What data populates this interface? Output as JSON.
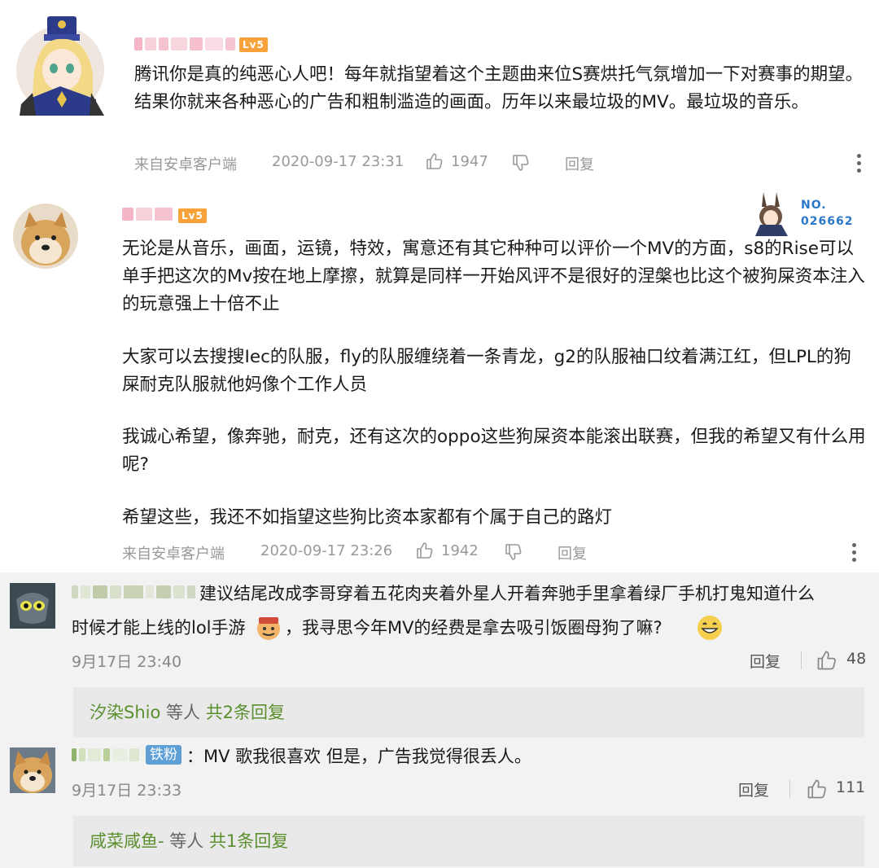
{
  "comments_top": [
    {
      "level_badge": "Lv5",
      "text": "腾讯你是真的纯恶心人吧！每年就指望着这个主题曲来位S赛烘托气氛增加一下对赛事的期望。结果你就来各种恶心的广告和粗制滥造的画面。历年以来最垃圾的MV。最垃圾的音乐。",
      "source": "来自安卓客户端",
      "time": "2020-09-17 23:31",
      "likes": "1947",
      "reply_label": "回复"
    },
    {
      "level_badge": "Lv5",
      "badge_no_label": "NO.",
      "badge_no_value": "026662",
      "paragraphs": [
        "无论是从音乐，画面，运镜，特效，寓意还有其它种种可以评价一个MV的方面，s8的Rise可以单手把这次的Mv按在地上摩擦，就算是同样一开始风评不是很好的涅槃也比这个被狗屎资本注入的玩意强上十倍不止",
        "大家可以去搜搜Iec的队服，fly的队服缠绕着一条青龙，g2的队服袖口纹着满江红，但LPL的狗屎耐克队服就他妈像个工作人员",
        "我诚心希望，像奔驰，耐克，还有这次的oppo这些狗屎资本能滚出联赛，但我的希望又有什么用呢?",
        "希望这些，我还不如指望这些狗比资本家都有个属于自己的路灯"
      ],
      "source": "来自安卓客户端",
      "time": "2020-09-17 23:26",
      "likes": "1942",
      "reply_label": "回复"
    }
  ],
  "comments_weibo": [
    {
      "text_a": "建议结尾改成李哥穿着五花肉夹着外星人开着奔驰手里拿着绿厂手机打鬼知道什么",
      "text_b": "时候才能上线的lol手游",
      "text_c": "，我寻思今年MV的经费是拿去吸引饭圈母狗了嘛?",
      "time": "9月17日 23:40",
      "reply_label": "回复",
      "likes": "48",
      "sub_reply_user": "汐染Shio",
      "sub_reply_mid": " 等人 ",
      "sub_reply_count": "共2条回复"
    },
    {
      "fan_badge": "铁粉",
      "text": "：MV 歌我很喜欢 但是，广告我觉得很丢人。",
      "time": "9月17日 23:33",
      "reply_label": "回复",
      "likes": "111",
      "sub_reply_user": "咸菜咸鱼-",
      "sub_reply_mid": " 等人 ",
      "sub_reply_count": "共1条回复"
    }
  ]
}
